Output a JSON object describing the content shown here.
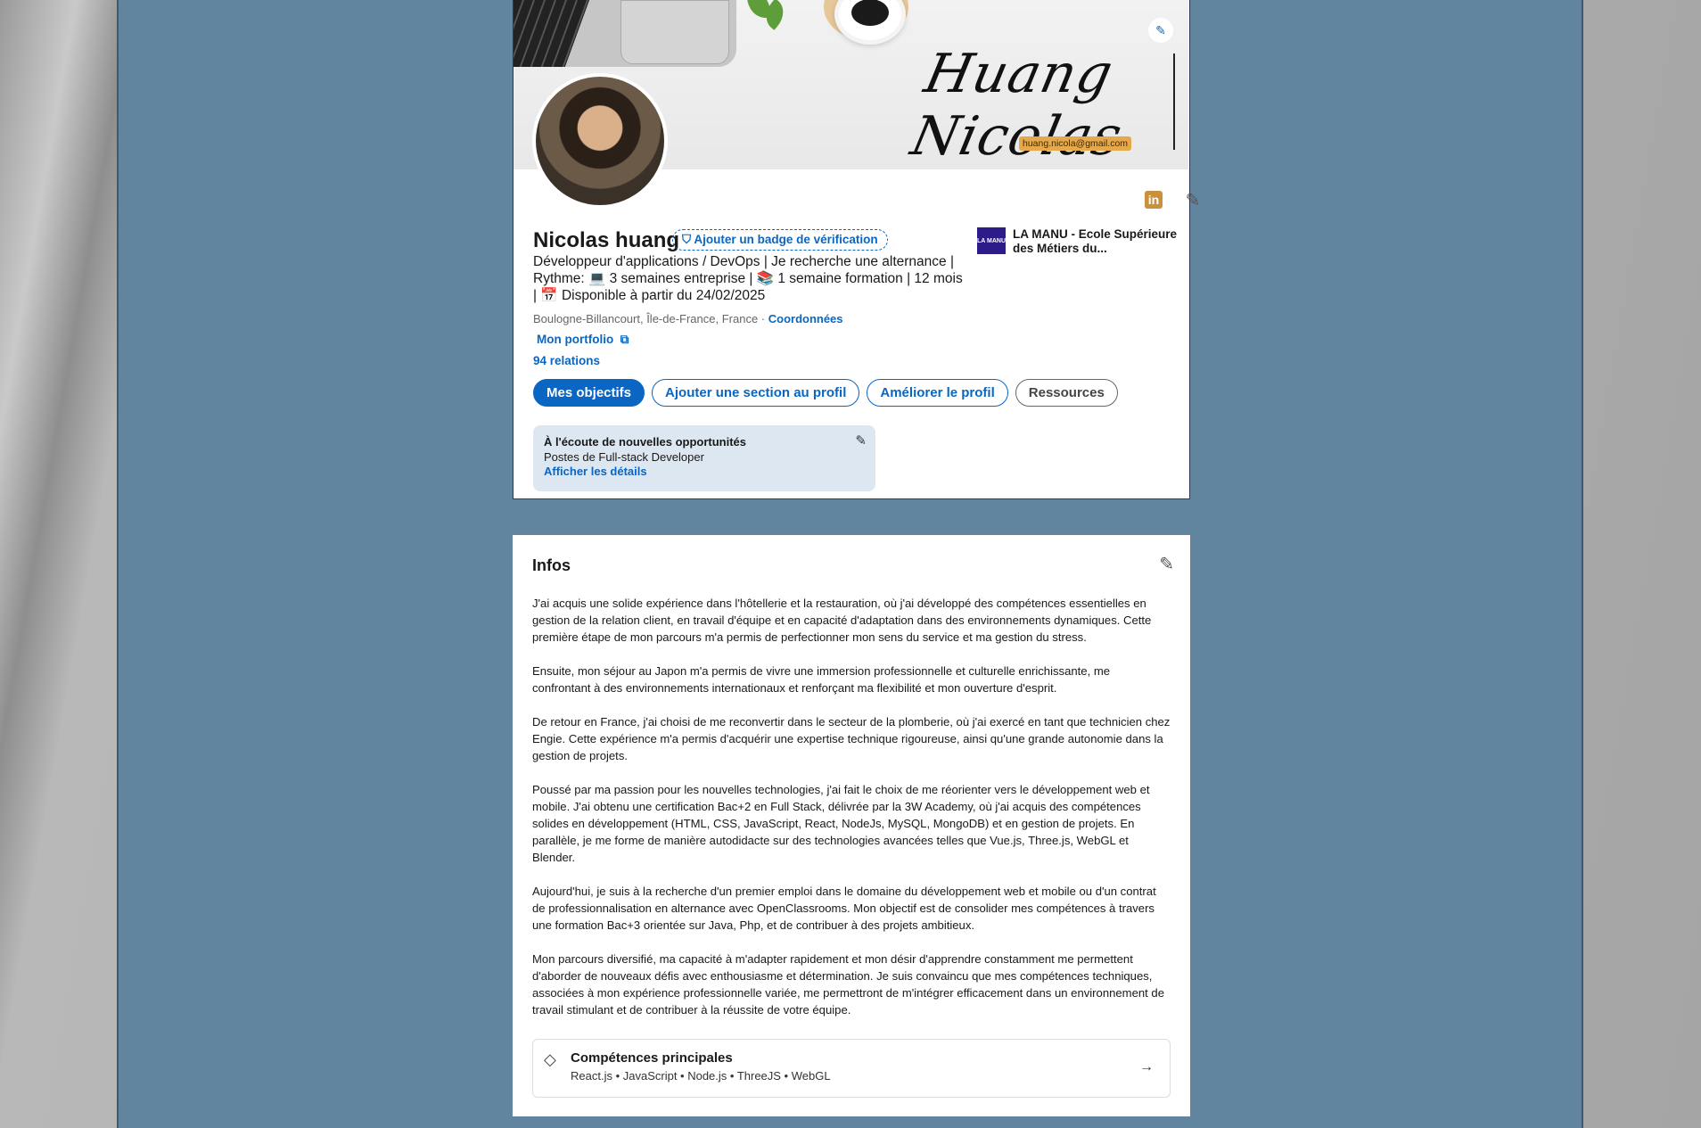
{
  "banner": {
    "signature": "Huang Nicolas",
    "email": "huang.nicola@gmail.com"
  },
  "profile": {
    "name": "Nicolas huang",
    "verify_badge": "Ajouter un badge de vérification",
    "headline": "Développeur d'applications / DevOps | Je recherche une alternance | Rythme: 💻 3 semaines entreprise | 📚 1 semaine formation | 12 mois | 📅 Disponible à partir du 24/02/2025",
    "school": "LA MANU - Ecole Supérieure des Métiers du...",
    "school_logo_text": "LA MANU",
    "location": "Boulogne-Billancourt, Île-de-France, France · ",
    "contact_link": "Coordonnées",
    "portfolio": "Mon portfolio",
    "relations": "94 relations",
    "buttons": {
      "objectives": "Mes objectifs",
      "add_section": "Ajouter une section au profil",
      "improve": "Améliorer le profil",
      "resources": "Ressources"
    },
    "open_to_work": {
      "title": "À l'écoute de nouvelles opportunités",
      "roles": "Postes de Full-stack Developer",
      "details_link": "Afficher les détails"
    }
  },
  "about": {
    "title": "Infos",
    "paragraphs": [
      "J'ai acquis une solide expérience dans l'hôtellerie et la restauration, où j'ai développé des compétences essentielles en gestion de la relation client, en travail d'équipe et en capacité d'adaptation dans des environnements dynamiques. Cette première étape de mon parcours m'a permis de perfectionner mon sens du service et ma gestion du stress.",
      "Ensuite, mon séjour au Japon m'a permis de vivre une immersion professionnelle et culturelle enrichissante, me confrontant à des environnements internationaux et renforçant ma flexibilité et mon ouverture d'esprit.",
      "De retour en France, j'ai choisi de me reconvertir dans le secteur de la plomberie, où j'ai exercé en tant que technicien chez Engie. Cette expérience m'a permis d'acquérir une expertise technique rigoureuse, ainsi qu'une grande autonomie dans la gestion de projets.",
      "Poussé par ma passion pour les nouvelles technologies, j'ai fait le choix de me réorienter vers le développement web et mobile. J'ai obtenu une certification Bac+2 en Full Stack, délivrée par la 3W Academy, où j'ai acquis des compétences solides en développement (HTML, CSS, JavaScript, React, NodeJs, MySQL, MongoDB) et en gestion de projets. En parallèle, je me forme de manière autodidacte sur des technologies avancées telles que Vue.js, Three.js, WebGL et Blender.",
      "Aujourd'hui, je suis à la recherche d'un premier emploi dans le domaine du développement web et mobile ou d'un contrat de professionnalisation en alternance avec OpenClassrooms. Mon objectif est de consolider mes compétences à travers une formation Bac+3 orientée sur Java, Php, et de contribuer à des projets ambitieux.",
      "Mon parcours diversifié, ma capacité à m'adapter rapidement et mon désir d'apprendre constamment me permettent d'aborder de nouveaux défis avec enthousiasme et détermination. Je suis convaincu que mes compétences techniques, associées à mon expérience professionnelle variée, me permettront de m'intégrer efficacement dans un environnement de travail stimulant et de contribuer à la réussite de votre équipe."
    ],
    "skills": {
      "title": "Compétences principales",
      "list": "React.js • JavaScript • Node.js • ThreeJS • WebGL"
    }
  },
  "colors": {
    "accent": "#0a66c2",
    "background": "#62859f",
    "open_to_work_bg": "#dde7f1"
  }
}
